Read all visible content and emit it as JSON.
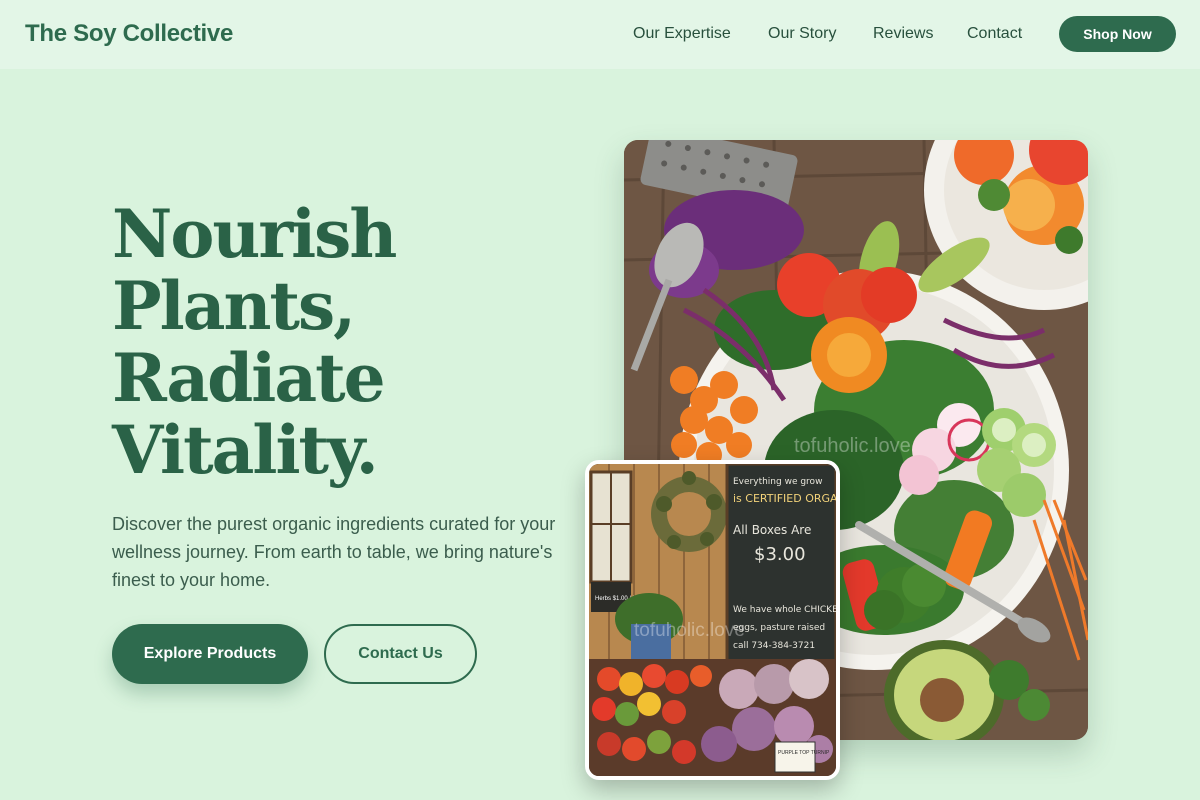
{
  "header": {
    "brand": "The Soy Collective",
    "nav": [
      "Our Expertise",
      "Our Story",
      "Reviews",
      "Contact"
    ],
    "cta": "Shop Now"
  },
  "hero": {
    "headline_lines": [
      "Nourish",
      "Plants,",
      "Radiate",
      "Vitality."
    ],
    "subtitle": "Discover the purest organic ingredients curated for your wellness journey. From earth to table, we bring nature's finest to your home.",
    "primary_button": "Explore Products",
    "secondary_button": "Contact Us"
  },
  "images": {
    "watermark": "tofuholic.love",
    "chalkboard_lines": [
      "Everything we grow",
      "is CERTIFIED ORGANIC",
      "All Boxes Are",
      "$3.00",
      "We have whole CHICKEN",
      "eggs, pasture raised",
      "call 734-384-3721"
    ],
    "price_tag": "PURPLE TOP TURNIP",
    "small_sign": "Herbs $1.00 / bunch",
    "colors": {
      "brand": "#2e6b4e",
      "page_bg": "#d9f3dd",
      "header_bg": "#e3f6e7"
    }
  }
}
